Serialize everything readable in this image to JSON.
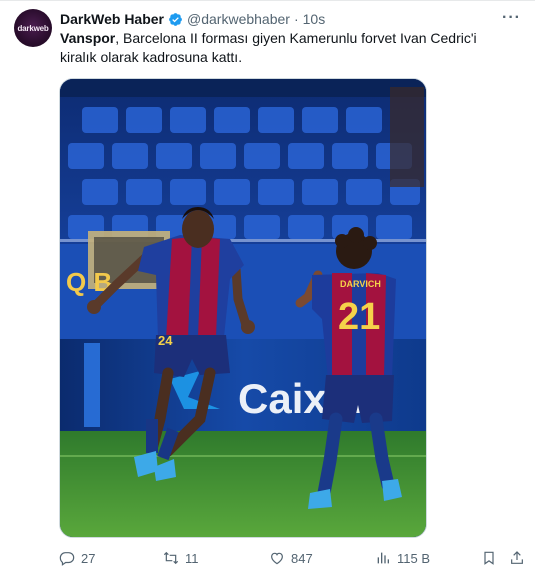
{
  "account": {
    "avatar_text": "darkweb",
    "name": "DarkWeb Haber",
    "handle": "@darkwebhaber",
    "separator": "·",
    "time": "10s",
    "more_glyph": "···"
  },
  "post": {
    "lead": "Vanspor",
    "text": ", Barcelona II forması giyen Kamerunlu forvet Ivan Cedric'i kiralık olarak kadrosuna kattı."
  },
  "media": {
    "player_left_number": "24",
    "player_right_name": "DARVICH",
    "player_right_number": "21",
    "stadium_banner": "Q        B",
    "sponsor_text": "CaixaB"
  },
  "actions": {
    "replies": "27",
    "retweets": "11",
    "likes": "847",
    "views": "115 B"
  },
  "colors": {
    "accent": "#1d9bf0",
    "muted": "#536471",
    "text": "#0f1419"
  },
  "icons": [
    "verified-badge-icon",
    "more-icon",
    "reply-icon",
    "retweet-icon",
    "like-icon",
    "views-icon",
    "bookmark-icon",
    "share-icon"
  ]
}
